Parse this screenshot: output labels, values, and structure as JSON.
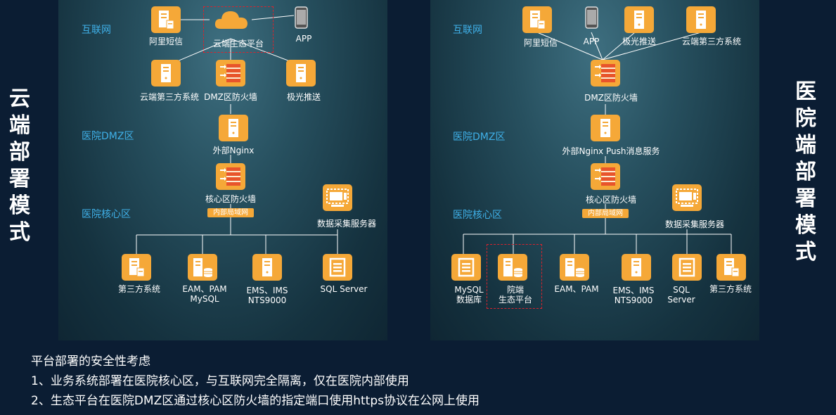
{
  "left_title": [
    "云",
    "端",
    "部",
    "署",
    "模",
    "式"
  ],
  "right_title": [
    "医",
    "院",
    "端",
    "部",
    "署",
    "模",
    "式"
  ],
  "left": {
    "zones": {
      "internet": "互联网",
      "dmz": "医院DMZ区",
      "core": "医院核心区"
    },
    "nodes": {
      "aliyun_sms": "阿里短信",
      "cloud_platform": "云端生态平台",
      "app": "APP",
      "cloud_third": "云端第三方系统",
      "dmz_firewall": "DMZ区防火墙",
      "jpush": "极光推送",
      "nginx": "外部Nginx",
      "core_firewall": "核心区防火墙",
      "intranet": "内部局域网",
      "collector": "数据采集服务器",
      "third": "第三方系统",
      "eam_l1": "EAM、PAM",
      "eam_l2": "MySQL",
      "ems_l1": "EMS、IMS",
      "ems_l2": "NTS9000",
      "sql": "SQL Server"
    }
  },
  "right": {
    "zones": {
      "internet": "互联网",
      "dmz": "医院DMZ区",
      "core": "医院核心区"
    },
    "nodes": {
      "aliyun_sms": "阿里短信",
      "app": "APP",
      "jpush": "极光推送",
      "cloud_third": "云端第三方系统",
      "dmz_firewall": "DMZ区防火墙",
      "nginx": "外部Nginx Push消息服务",
      "core_firewall": "核心区防火墙",
      "intranet": "内部局域网",
      "collector": "数据采集服务器",
      "mysql_l1": "MySQL",
      "mysql_l2": "数据库",
      "hosp_l1": "院端",
      "hosp_l2": "生态平台",
      "eam": "EAM、PAM",
      "ems_l1": "EMS、IMS",
      "ems_l2": "NTS9000",
      "sql_l1": "SQL",
      "sql_l2": "Server",
      "third": "第三方系统"
    }
  },
  "notes": {
    "heading": "平台部署的安全性考虑",
    "line1": "1、业务系统部署在医院核心区，与互联网完全隔离，仅在医院内部使用",
    "line2": "2、生态平台在医院DMZ区通过核心区防火墙的指定端口使用https协议在公网上使用"
  },
  "colors": {
    "node": "#f5a838",
    "zone": "#3fb0e8",
    "dashed": "#d9232d",
    "line": "#ffffff"
  }
}
